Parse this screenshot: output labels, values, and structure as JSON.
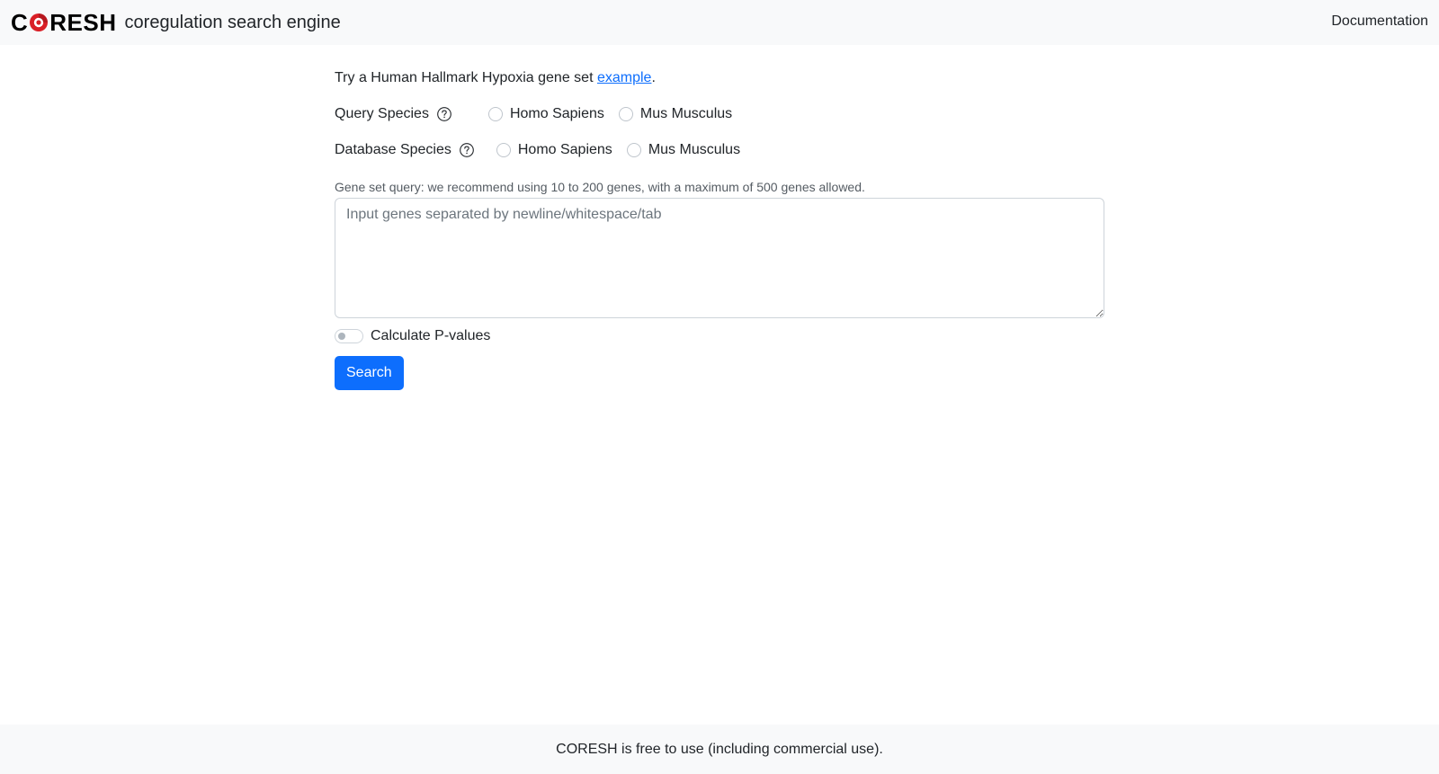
{
  "header": {
    "logo_text_pre": "C",
    "logo_text_post": "RESH",
    "tagline": "coregulation search engine",
    "nav_documentation": "Documentation",
    "logo_accent": "#d91f26"
  },
  "main": {
    "example_prefix": "Try a Human Hallmark Hypoxia gene set",
    "example_link": "example",
    "example_suffix": ".",
    "query_species": {
      "label": "Query Species",
      "options": [
        "Homo Sapiens",
        "Mus Musculus"
      ]
    },
    "database_species": {
      "label": "Database Species",
      "options": [
        "Homo Sapiens",
        "Mus Musculus"
      ]
    },
    "gene_hint": "Gene set query: we recommend using 10 to 200 genes, with a maximum of 500 genes allowed.",
    "gene_placeholder": "Input genes separated by newline/whitespace/tab",
    "pvalue_label": "Calculate P-values",
    "pvalue_enabled": false,
    "search_label": "Search"
  },
  "footer": {
    "text": "CORESH is free to use (including commercial use)."
  },
  "colors": {
    "primary": "#0d6efd",
    "navbar_bg": "#f8f9fa",
    "link": "#0d6efd"
  }
}
